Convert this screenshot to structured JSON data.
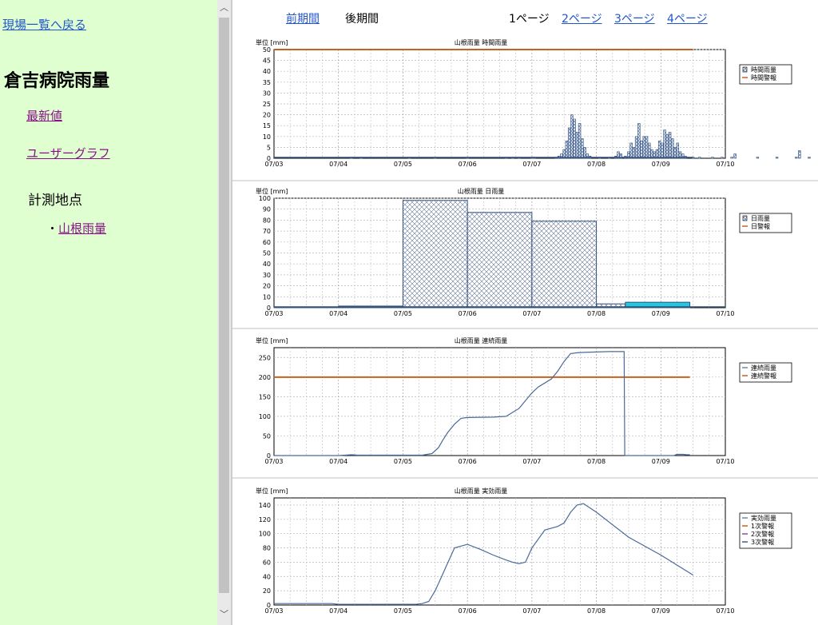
{
  "sidebar": {
    "back_link": "現場一覧へ戻る",
    "site_title": "倉吉病院雨量",
    "menu_latest": "最新値",
    "menu_user_graph": "ユーザーグラフ",
    "points_label": "計測地点",
    "point_bullet": "・",
    "point_name": "山根雨量"
  },
  "topnav": {
    "prev_period": "前期間",
    "next_period": "後期間",
    "page1": "1ページ",
    "page2": "2ページ",
    "page3": "3ページ",
    "page4": "4ページ"
  },
  "colors": {
    "sidebar_bg": "#dfffd0",
    "line": "#4a6a9a",
    "warning": "#c8601e",
    "highlight_bar": "#20c8e0"
  },
  "chart_data": [
    {
      "type": "bar",
      "title": "山根雨量 時間雨量",
      "unit": "単位 [mm]",
      "x_ticks": [
        "07/03",
        "07/04",
        "07/05",
        "07/06",
        "07/07",
        "07/08",
        "07/09",
        "07/10"
      ],
      "ylim": [
        0,
        50
      ],
      "y_ticks": [
        0,
        5,
        10,
        15,
        20,
        25,
        30,
        35,
        40,
        45,
        50
      ],
      "grid": true,
      "legend_position": "right",
      "legend": [
        "時間雨量",
        "時間警報"
      ],
      "warning_level": 50,
      "warning_end_day": 6.5,
      "bars": [
        [
          1.2,
          0.5
        ],
        [
          1.35,
          0.5
        ],
        [
          2.1,
          0.5
        ],
        [
          2.5,
          0.5
        ],
        [
          3.0,
          0.5
        ],
        [
          3.6,
          0.5
        ],
        [
          3.7,
          0.5
        ],
        [
          3.8,
          0.5
        ],
        [
          4.0,
          0.5
        ],
        [
          4.04,
          0.5
        ],
        [
          4.38,
          0.5
        ],
        [
          4.42,
          1
        ],
        [
          4.46,
          2
        ],
        [
          4.5,
          4
        ],
        [
          4.54,
          8
        ],
        [
          4.58,
          14
        ],
        [
          4.62,
          20
        ],
        [
          4.66,
          18
        ],
        [
          4.7,
          12
        ],
        [
          4.74,
          16
        ],
        [
          4.78,
          9
        ],
        [
          4.82,
          5
        ],
        [
          4.86,
          2
        ],
        [
          4.9,
          1
        ],
        [
          5.05,
          0.5
        ],
        [
          5.2,
          0.5
        ],
        [
          5.3,
          1
        ],
        [
          5.34,
          3
        ],
        [
          5.38,
          2
        ],
        [
          5.45,
          1
        ],
        [
          5.5,
          3
        ],
        [
          5.54,
          7
        ],
        [
          5.58,
          5
        ],
        [
          5.62,
          10
        ],
        [
          5.66,
          16
        ],
        [
          5.7,
          8
        ],
        [
          5.74,
          10
        ],
        [
          5.78,
          10
        ],
        [
          5.82,
          7
        ],
        [
          5.86,
          4
        ],
        [
          5.9,
          3
        ],
        [
          5.94,
          4
        ],
        [
          5.98,
          8
        ],
        [
          6.02,
          7
        ],
        [
          6.06,
          13
        ],
        [
          6.1,
          11
        ],
        [
          6.14,
          12
        ],
        [
          6.18,
          9
        ],
        [
          6.22,
          5
        ],
        [
          6.26,
          7
        ],
        [
          6.3,
          3
        ],
        [
          6.34,
          2
        ],
        [
          6.38,
          1
        ],
        [
          6.5,
          0.5
        ],
        [
          6.6,
          0.5
        ],
        [
          6.8,
          0.5
        ],
        [
          6.95,
          0.5
        ],
        [
          7.1,
          0.5
        ],
        [
          7.15,
          2
        ],
        [
          7.5,
          0.5
        ],
        [
          7.8,
          0.5
        ],
        [
          8.1,
          0.5
        ],
        [
          8.15,
          3.5
        ],
        [
          8.3,
          0.5
        ]
      ]
    },
    {
      "type": "bar",
      "title": "山根雨量 日雨量",
      "unit": "単位 [mm]",
      "x_ticks": [
        "07/03",
        "07/04",
        "07/05",
        "07/06",
        "07/07",
        "07/08",
        "07/09",
        "07/10"
      ],
      "ylim": [
        0,
        100
      ],
      "y_ticks": [
        0,
        10,
        20,
        30,
        40,
        50,
        60,
        70,
        80,
        90,
        100
      ],
      "grid": true,
      "legend_position": "right",
      "legend": [
        "日雨量",
        "日警報"
      ],
      "days": [
        {
          "start": 0,
          "end": 1,
          "value": 0.5
        },
        {
          "start": 1,
          "end": 2,
          "value": 1.5
        },
        {
          "start": 2,
          "end": 3,
          "value": 98
        },
        {
          "start": 3,
          "end": 4,
          "value": 87
        },
        {
          "start": 4,
          "end": 5,
          "value": 79
        },
        {
          "start": 5,
          "end": 5.45,
          "value": 3.5
        },
        {
          "start": 5.45,
          "end": 6.45,
          "value": 5,
          "highlight": true
        }
      ]
    },
    {
      "type": "line",
      "title": "山根雨量 連続雨量",
      "unit": "単位 [mm]",
      "x_ticks": [
        "07/03",
        "07/04",
        "07/05",
        "07/06",
        "07/07",
        "07/08",
        "07/09",
        "07/10"
      ],
      "ylim": [
        0,
        275
      ],
      "y_ticks": [
        0,
        50,
        100,
        150,
        200,
        250
      ],
      "grid": true,
      "legend_position": "right",
      "legend": [
        "連続雨量",
        "連続警報"
      ],
      "warning_level": 200,
      "warning_end_day": 6.45,
      "series": [
        {
          "x": [
            0,
            1.0,
            1.2,
            1.3,
            2.0,
            2.3,
            2.45,
            2.55,
            2.62,
            2.7,
            2.8,
            2.9,
            3.0,
            3.4,
            3.6,
            3.7,
            3.8,
            3.9,
            4.0,
            4.1,
            4.2,
            4.3,
            4.4,
            4.5,
            4.6,
            4.7,
            4.8,
            5.0,
            5.2,
            5.43,
            5.44,
            5.6,
            6.2,
            6.25,
            6.35,
            6.4,
            6.45
          ],
          "y": [
            0,
            0,
            2,
            1,
            1,
            1,
            5,
            20,
            40,
            60,
            80,
            95,
            97,
            98,
            100,
            110,
            120,
            140,
            160,
            175,
            185,
            195,
            215,
            240,
            260,
            262,
            263,
            264,
            265,
            265,
            0,
            0,
            0,
            3,
            3,
            2,
            2
          ]
        }
      ]
    },
    {
      "type": "line",
      "title": "山根雨量 実効雨量",
      "unit": "単位 [mm]",
      "x_ticks": [
        "07/03",
        "07/04",
        "07/05",
        "07/06",
        "07/07",
        "07/08",
        "07/09",
        "07/10"
      ],
      "ylim": [
        0,
        150
      ],
      "y_ticks": [
        0,
        20,
        40,
        60,
        80,
        100,
        120,
        140
      ],
      "grid": true,
      "legend_position": "right",
      "legend": [
        "実効雨量",
        "1次警報",
        "2次警報",
        "3次警報"
      ],
      "series": [
        {
          "x": [
            0,
            0.9,
            1.0,
            1.3,
            2.0,
            2.2,
            2.3,
            2.4,
            2.5,
            2.6,
            2.7,
            2.8,
            3.0,
            3.2,
            3.4,
            3.6,
            3.7,
            3.8,
            3.9,
            4.0,
            4.2,
            4.4,
            4.5,
            4.6,
            4.7,
            4.8,
            5.0,
            5.5,
            6.0,
            6.5
          ],
          "y": [
            2,
            2,
            1,
            1,
            1,
            1,
            2,
            5,
            20,
            40,
            60,
            80,
            85,
            78,
            70,
            63,
            60,
            58,
            60,
            80,
            105,
            110,
            115,
            130,
            140,
            142,
            130,
            95,
            70,
            42
          ]
        }
      ]
    }
  ]
}
